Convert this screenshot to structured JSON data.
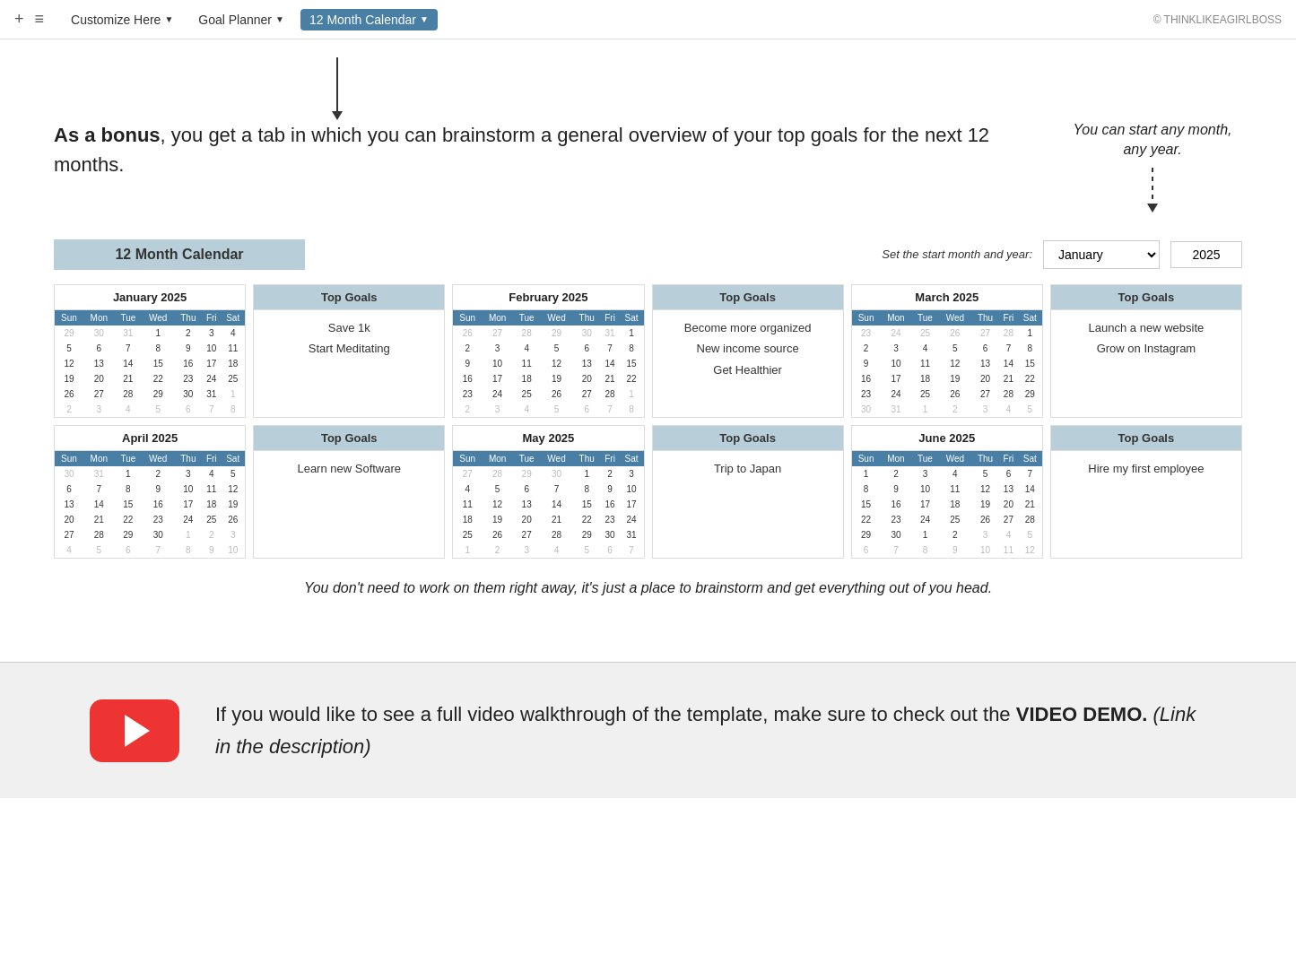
{
  "nav": {
    "plus_label": "+",
    "hamburger_label": "≡",
    "customize_label": "Customize Here",
    "customize_arrow": "▼",
    "goal_planner_label": "Goal Planner",
    "goal_planner_arrow": "▼",
    "calendar_label": "12 Month Calendar",
    "calendar_arrow": "▼",
    "copyright": "© THINKLIKEAGIRLBOSS"
  },
  "intro": {
    "bold_text": "As a bonus",
    "rest_text": ", you get a tab in which you can brainstorm a general overview of your top goals for the next 12 months.",
    "side_note": "You can start any month, any year."
  },
  "calendar_section": {
    "title": "12 Month Calendar",
    "start_label": "Set the start month and year:",
    "start_month": "January",
    "start_year": "2025",
    "months": [
      {
        "name": "January 2025",
        "days": [
          [
            "29",
            "30",
            "31",
            "1",
            "2",
            "3",
            "4"
          ],
          [
            "5",
            "6",
            "7",
            "8",
            "9",
            "10",
            "11"
          ],
          [
            "12",
            "13",
            "14",
            "15",
            "16",
            "17",
            "18"
          ],
          [
            "19",
            "20",
            "21",
            "22",
            "23",
            "24",
            "25"
          ],
          [
            "26",
            "27",
            "28",
            "29",
            "30",
            "31",
            "1"
          ],
          [
            "2",
            "3",
            "4",
            "5",
            "6",
            "7",
            "8"
          ]
        ],
        "other_month_start": [
          0,
          1,
          2
        ],
        "other_month_end_row5": [
          6
        ],
        "other_month_end_row6": [
          0,
          1,
          2,
          3,
          4,
          5,
          6
        ]
      },
      {
        "name": "February 2025",
        "days": [
          [
            "26",
            "27",
            "28",
            "29",
            "30",
            "31",
            "1"
          ],
          [
            "2",
            "3",
            "4",
            "5",
            "6",
            "7",
            "8"
          ],
          [
            "9",
            "10",
            "11",
            "12",
            "13",
            "14",
            "15"
          ],
          [
            "16",
            "17",
            "18",
            "19",
            "20",
            "21",
            "22"
          ],
          [
            "23",
            "24",
            "25",
            "26",
            "27",
            "28",
            "1"
          ],
          [
            "2",
            "3",
            "4",
            "5",
            "6",
            "7",
            "8"
          ]
        ],
        "other_month_start_row0": [
          0,
          1,
          2,
          3,
          4,
          5
        ],
        "other_month_end_row4": [
          6
        ],
        "other_month_end_row5": [
          0,
          1,
          2,
          3,
          4,
          5,
          6
        ]
      },
      {
        "name": "March 2025",
        "days": [
          [
            "23",
            "24",
            "25",
            "26",
            "27",
            "28",
            "1"
          ],
          [
            "2",
            "3",
            "4",
            "5",
            "6",
            "7",
            "8"
          ],
          [
            "9",
            "10",
            "11",
            "12",
            "13",
            "14",
            "15"
          ],
          [
            "16",
            "17",
            "18",
            "19",
            "20",
            "21",
            "22"
          ],
          [
            "23",
            "24",
            "25",
            "26",
            "27",
            "28",
            "29"
          ],
          [
            "30",
            "31",
            "1",
            "2",
            "3",
            "4",
            "5"
          ]
        ],
        "other_month_start_row0": [
          0,
          1,
          2,
          3,
          4,
          5
        ],
        "other_month_end_row5": [
          2,
          3,
          4,
          5,
          6
        ]
      },
      {
        "name": "April 2025",
        "days": [
          [
            "30",
            "31",
            "1",
            "2",
            "3",
            "4",
            "5"
          ],
          [
            "6",
            "7",
            "8",
            "9",
            "10",
            "11",
            "12"
          ],
          [
            "13",
            "14",
            "15",
            "16",
            "17",
            "18",
            "19"
          ],
          [
            "20",
            "21",
            "22",
            "23",
            "24",
            "25",
            "26"
          ],
          [
            "27",
            "28",
            "29",
            "30",
            "1",
            "2",
            "3"
          ],
          [
            "4",
            "5",
            "6",
            "7",
            "8",
            "9",
            "10"
          ]
        ],
        "other_month_start_row0": [
          0,
          1
        ],
        "other_month_end_row4": [
          4,
          5,
          6
        ],
        "other_month_end_row5": [
          0,
          1,
          2,
          3,
          4,
          5,
          6
        ]
      },
      {
        "name": "May 2025",
        "days": [
          [
            "27",
            "28",
            "29",
            "30",
            "1",
            "2",
            "3"
          ],
          [
            "4",
            "5",
            "6",
            "7",
            "8",
            "9",
            "10"
          ],
          [
            "11",
            "12",
            "13",
            "14",
            "15",
            "16",
            "17"
          ],
          [
            "18",
            "19",
            "20",
            "21",
            "22",
            "23",
            "24"
          ],
          [
            "25",
            "26",
            "27",
            "28",
            "29",
            "30",
            "31"
          ],
          [
            "1",
            "2",
            "3",
            "4",
            "5",
            "6",
            "7"
          ]
        ],
        "other_month_start_row0": [
          0,
          1,
          2,
          3
        ],
        "other_month_end_row5": [
          0,
          1,
          2,
          3,
          4,
          5,
          6
        ]
      },
      {
        "name": "June 2025",
        "days": [
          [
            "1",
            "2",
            "3",
            "4",
            "5",
            "6",
            "7"
          ],
          [
            "8",
            "9",
            "10",
            "11",
            "12",
            "13",
            "14"
          ],
          [
            "15",
            "16",
            "17",
            "18",
            "19",
            "20",
            "21"
          ],
          [
            "22",
            "23",
            "24",
            "25",
            "26",
            "27",
            "28"
          ],
          [
            "29",
            "30",
            "1",
            "2",
            "3",
            "4",
            "5"
          ],
          [
            "6",
            "7",
            "8",
            "9",
            "10",
            "11",
            "12"
          ]
        ],
        "other_month_end_row4": [
          2,
          3,
          4,
          5,
          6
        ],
        "other_month_end_row5": [
          0,
          1,
          2,
          3,
          4,
          5,
          6
        ]
      }
    ],
    "top_goals": [
      {
        "goals": [
          "Save 1k",
          "Start Meditating"
        ]
      },
      {
        "goals": [
          "Become more organized",
          "New income source",
          "Get Healthier"
        ]
      },
      {
        "goals": [
          "Launch a new website",
          "Grow on Instagram"
        ]
      },
      {
        "goals": [
          "Learn new Software"
        ]
      },
      {
        "goals": [
          "Trip to Japan"
        ]
      },
      {
        "goals": [
          "Hire my first employee"
        ]
      }
    ],
    "top_goals_header": "Top Goals",
    "week_days": [
      "Sun",
      "Mon",
      "Tue",
      "Wed",
      "Thu",
      "Fri",
      "Sat"
    ]
  },
  "bottom_note": "You don't need to work on them right away, it's just a place to brainstorm and get everything out of you head.",
  "video_section": {
    "text_before": "If you would like to see a full video walkthrough of the template, make sure to check out the ",
    "bold": "VIDEO DEMO.",
    "italic": " (Link in the description)"
  }
}
